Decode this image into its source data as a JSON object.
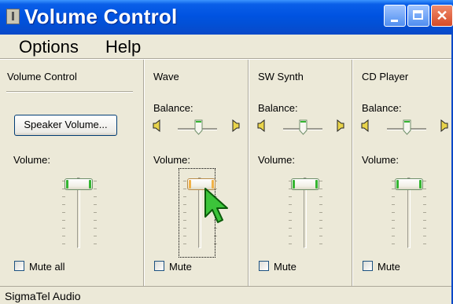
{
  "window": {
    "title": "Volume Control",
    "buttons": {
      "minimize": "minimize",
      "maximize": "maximize",
      "close": "✕"
    }
  },
  "menu": {
    "items": [
      {
        "label": "Options"
      },
      {
        "label": "Help"
      }
    ]
  },
  "columns": [
    {
      "title": "Volume Control",
      "speaker_button": "Speaker Volume...",
      "volume_label": "Volume:",
      "volume_level": 1.0,
      "mute_label": "Mute all",
      "muted": false
    },
    {
      "title": "Wave",
      "balance_label": "Balance:",
      "balance": 0.5,
      "volume_label": "Volume:",
      "volume_level": 1.0,
      "mute_label": "Mute",
      "muted": false,
      "focused": true
    },
    {
      "title": "SW Synth",
      "balance_label": "Balance:",
      "balance": 0.5,
      "volume_label": "Volume:",
      "volume_level": 1.0,
      "mute_label": "Mute",
      "muted": false
    },
    {
      "title": "CD Player",
      "balance_label": "Balance:",
      "balance": 0.5,
      "volume_label": "Volume:",
      "volume_level": 1.0,
      "mute_label": "Mute",
      "muted": false
    }
  ],
  "status": {
    "text": "SigmaTel Audio"
  },
  "colors": {
    "titlebar": "#0053e1",
    "thumb_accent": "#34b531",
    "focused_thumb_accent": "#f0b248"
  }
}
